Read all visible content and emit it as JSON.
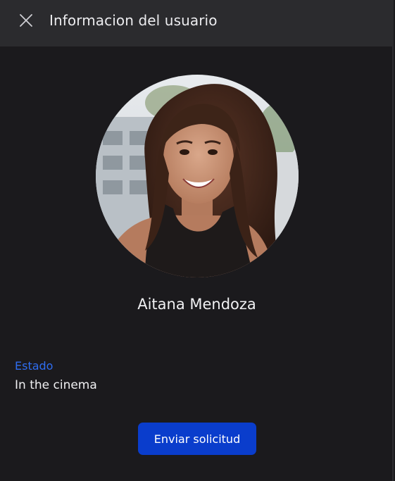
{
  "header": {
    "title": "Informacion del usuario",
    "close_icon": "close-icon"
  },
  "profile": {
    "name": "Aitana Mendoza",
    "status_label": "Estado",
    "status_value": "In the cinema"
  },
  "actions": {
    "send_request_label": "Enviar solicitud"
  },
  "colors": {
    "background": "#1b1a1d",
    "header_background": "#2b2b2e",
    "accent": "#2f6df0",
    "button": "#0a3dcc"
  }
}
